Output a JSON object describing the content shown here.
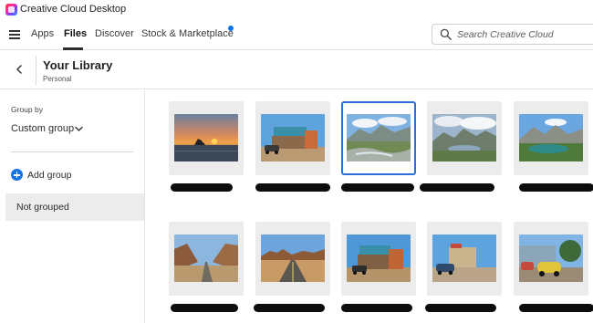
{
  "window": {
    "title": "Creative Cloud Desktop"
  },
  "nav": {
    "tabs": [
      {
        "label": "Apps",
        "active": false
      },
      {
        "label": "Files",
        "active": true
      },
      {
        "label": "Discover",
        "active": false
      },
      {
        "label": "Stock & Marketplace",
        "active": false,
        "has_notification": true
      }
    ],
    "search": {
      "placeholder": "Search Creative Cloud"
    }
  },
  "header": {
    "title": "Your Library",
    "subtitle": "Personal"
  },
  "sidebar": {
    "group_by_label": "Group by",
    "group_by_value": "Custom group",
    "add_group_label": "Add group",
    "items": [
      {
        "label": "Not grouped",
        "selected": true
      }
    ]
  },
  "library": {
    "items": [
      {
        "thumbnail": "sunset-sea-rocks",
        "selected": false
      },
      {
        "thumbnail": "roadside-trading-post",
        "selected": false
      },
      {
        "thumbnail": "mountain-stream",
        "selected": true
      },
      {
        "thumbnail": "mountain-lake-clouds",
        "selected": false
      },
      {
        "thumbnail": "alpine-lake",
        "selected": false
      },
      {
        "thumbnail": "canyon-road",
        "selected": false
      },
      {
        "thumbnail": "desert-highway",
        "selected": false
      },
      {
        "thumbnail": "roadside-trading-post-2",
        "selected": false
      },
      {
        "thumbnail": "route66-street",
        "selected": false
      },
      {
        "thumbnail": "vintage-cars-motel",
        "selected": false
      }
    ]
  },
  "colors": {
    "accent": "#1473e6",
    "selection": "#2c6fd6"
  }
}
